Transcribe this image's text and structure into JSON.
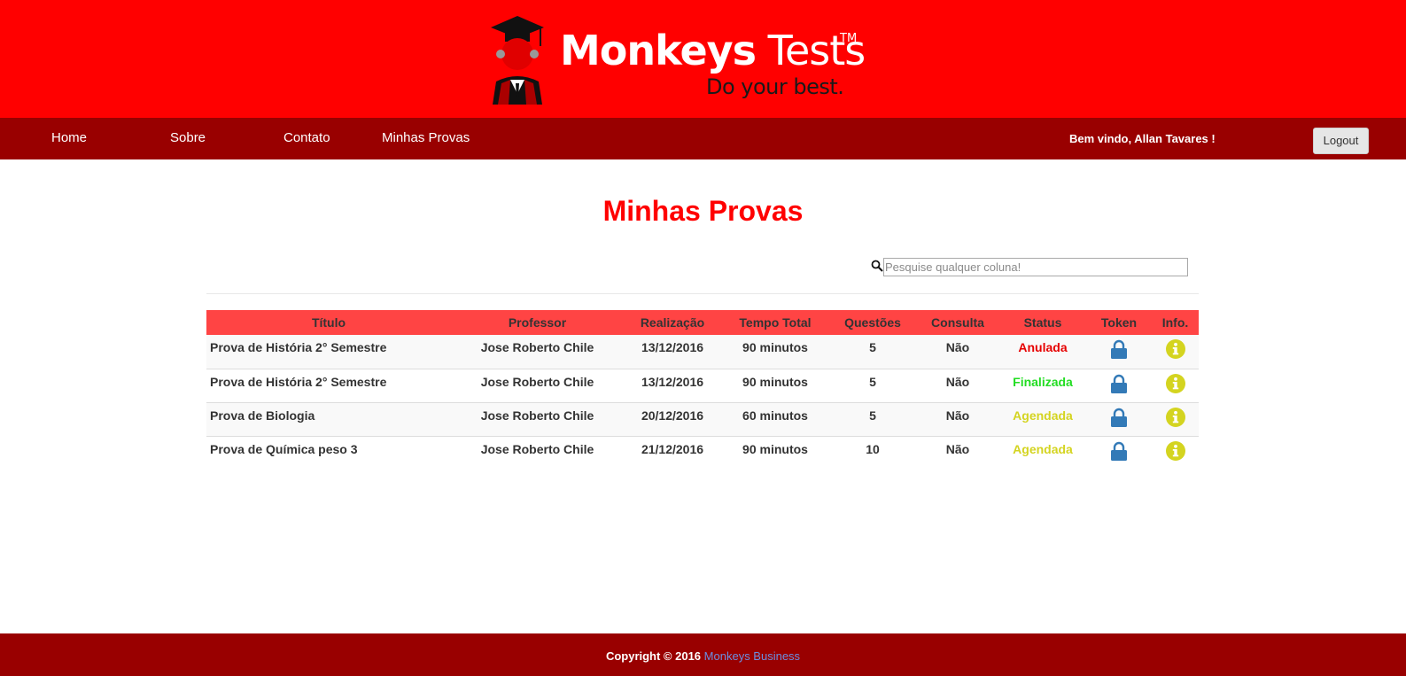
{
  "header": {
    "logo": {
      "name_bold": "Monkeys",
      "name_regular": "Tests",
      "trademark": "TM",
      "tagline": "Do your best."
    }
  },
  "nav": {
    "items": [
      {
        "label": "Home"
      },
      {
        "label": "Sobre"
      },
      {
        "label": "Contato"
      },
      {
        "label": "Minhas Provas"
      }
    ],
    "welcome": "Bem vindo, Allan Tavares !",
    "logout_label": "Logout"
  },
  "main": {
    "title": "Minhas Provas",
    "search": {
      "placeholder": "Pesquise qualquer coluna!",
      "value": ""
    },
    "table": {
      "headers": [
        "Título",
        "Professor",
        "Realização",
        "Tempo Total",
        "Questões",
        "Consulta",
        "Status",
        "Token",
        "Info."
      ],
      "rows": [
        {
          "titulo": "Prova de História 2° Semestre",
          "professor": "Jose Roberto Chile",
          "realizacao": "13/12/2016",
          "tempo": "90 minutos",
          "questoes": "5",
          "consulta": "Não",
          "status": "Anulada"
        },
        {
          "titulo": "Prova de História 2° Semestre",
          "professor": "Jose Roberto Chile",
          "realizacao": "13/12/2016",
          "tempo": "90 minutos",
          "questoes": "5",
          "consulta": "Não",
          "status": "Finalizada"
        },
        {
          "titulo": "Prova de Biologia",
          "professor": "Jose Roberto Chile",
          "realizacao": "20/12/2016",
          "tempo": "60 minutos",
          "questoes": "5",
          "consulta": "Não",
          "status": "Agendada"
        },
        {
          "titulo": "Prova de Química peso 3",
          "professor": "Jose Roberto Chile",
          "realizacao": "21/12/2016",
          "tempo": "90 minutos",
          "questoes": "10",
          "consulta": "Não",
          "status": "Agendada"
        }
      ]
    }
  },
  "footer": {
    "copyright": "Copyright © 2016",
    "link_label": "Monkeys Business"
  },
  "colors": {
    "header_bg": "#ff0000",
    "nav_bg": "#990000",
    "table_header_bg": "#ff4444",
    "status_anulada": "#e60000",
    "status_finalizada": "#22dd22",
    "status_agendada": "#d4d420",
    "lock_icon": "#337ab7",
    "info_icon": "#d4d420"
  },
  "icons": {
    "search": "search-icon",
    "token": "lock-icon",
    "info": "info-icon",
    "logo": "graduate-monkey-icon"
  }
}
